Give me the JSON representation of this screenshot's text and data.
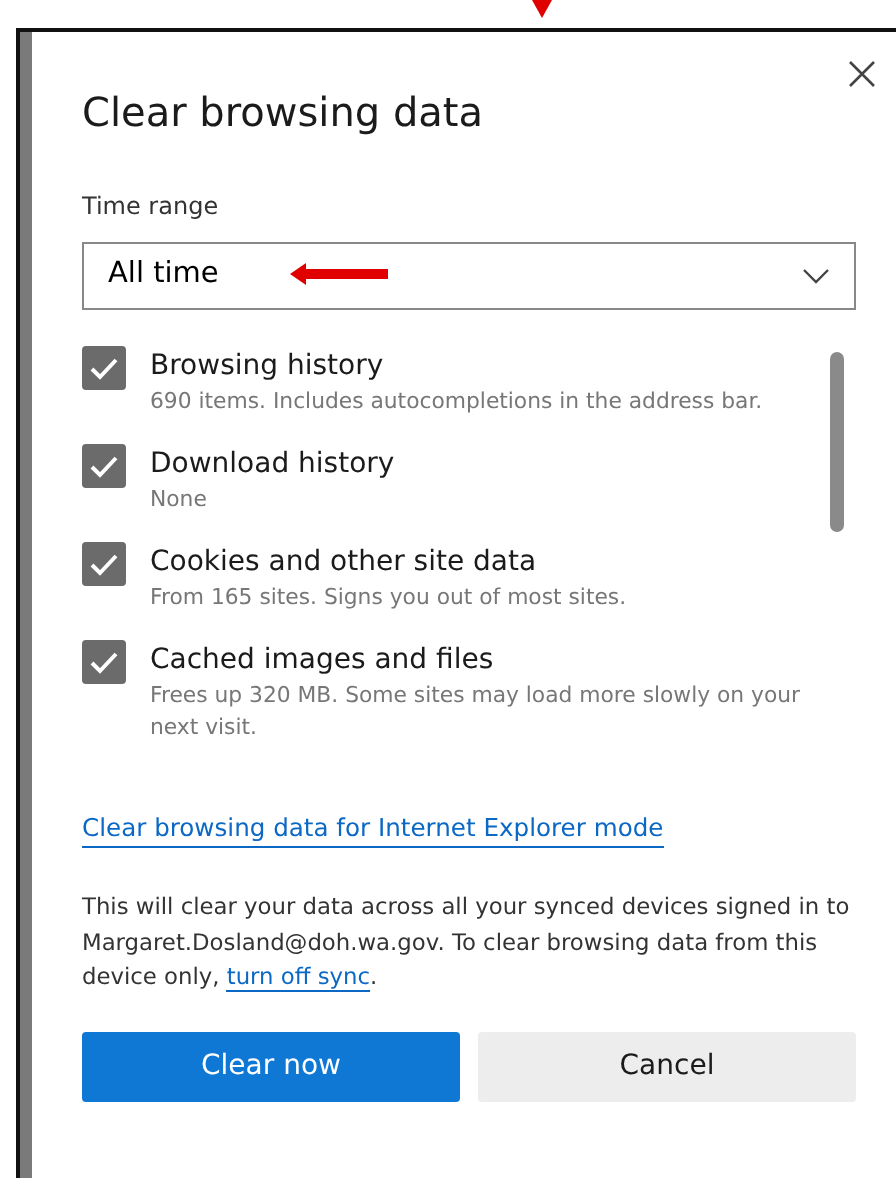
{
  "dialog": {
    "title": "Clear browsing data",
    "time_range": {
      "label": "Time range",
      "value": "All time"
    },
    "items": [
      {
        "label": "Browsing history",
        "description": "690 items. Includes autocompletions in the address bar.",
        "checked": true
      },
      {
        "label": "Download history",
        "description": "None",
        "checked": true
      },
      {
        "label": "Cookies and other site data",
        "description": "From 165 sites. Signs you out of most sites.",
        "checked": true
      },
      {
        "label": "Cached images and files",
        "description": "Frees up 320 MB. Some sites may load more slowly on your next visit.",
        "checked": true
      }
    ],
    "ie_link": "Clear browsing data for Internet Explorer mode",
    "sync_note": {
      "text": "This will clear your data across all your synced devices signed in to Margaret.Dosland@doh.wa.gov. To clear browsing data from this device only, ",
      "link": "turn off sync",
      "end": "."
    },
    "buttons": [
      {
        "label": "Clear now",
        "kind": "primary"
      },
      {
        "label": "Cancel",
        "kind": "secondary"
      }
    ]
  }
}
